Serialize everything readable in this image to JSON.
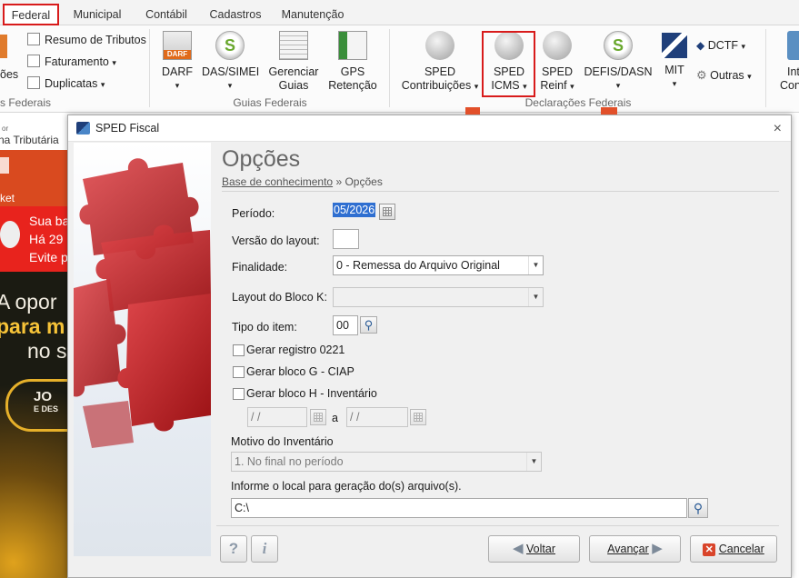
{
  "ribbon_tabs": [
    "Federal",
    "Municipal",
    "Contábil",
    "Cadastros",
    "Manutenção"
  ],
  "ribbon": {
    "left_cut_label": "ões",
    "left_cut_group": "s Federais",
    "small_buttons": [
      "Resumo de Tributos",
      "Faturamento",
      "Duplicatas"
    ],
    "guias": {
      "buttons": [
        {
          "line1": "DARF",
          "line2": "",
          "icon_text": "DARF"
        },
        {
          "line1": "DAS/SIMEI",
          "line2": ""
        },
        {
          "line1": "Gerenciar",
          "line2": "Guias"
        },
        {
          "line1": "GPS",
          "line2": "Retenção"
        }
      ],
      "group_label": "Guias Federais"
    },
    "declaracoes": {
      "buttons": [
        {
          "line1": "SPED",
          "line2": "Contribuições"
        },
        {
          "line1": "SPED",
          "line2": "ICMS"
        },
        {
          "line1": "SPED",
          "line2": "Reinf"
        },
        {
          "line1": "DEFIS/DASN",
          "line2": ""
        },
        {
          "line1": "MIT",
          "line2": ""
        }
      ],
      "dctf_label": "DCTF",
      "outras_label": "Outras",
      "group_label": "Declarações Federais"
    },
    "right_cut": {
      "line1": "Int",
      "line2": "Con"
    }
  },
  "side_panel": {
    "top_small": "or",
    "header": "na Tributária",
    "ket": "ket",
    "banner_lines": [
      "Sua ba",
      "Há 29",
      "Evite p"
    ],
    "promo_lines": [
      "A opor",
      "para m",
      "no s"
    ],
    "button_top": "JO",
    "button_bottom": "E DES"
  },
  "dialog": {
    "window_title": "SPED Fiscal",
    "close_glyph": "×",
    "heading": "Opções",
    "breadcrumb_link": "Base de conhecimento",
    "breadcrumb_sep": "»",
    "breadcrumb_current": "Opções",
    "periodo_label": "Período:",
    "periodo_value": "05/2026",
    "versao_label": "Versão do layout:",
    "versao_value": "",
    "finalidade_label": "Finalidade:",
    "finalidade_value": "0 - Remessa do Arquivo Original",
    "layout_bloco_k_label": "Layout do Bloco K:",
    "layout_bloco_k_value": "",
    "tipo_item_label": "Tipo do item:",
    "tipo_item_value": "00",
    "gerar_0221_label": "Gerar registro 0221",
    "gerar_0221_checked": false,
    "gerar_g_label": "Gerar bloco G - CIAP",
    "gerar_g_checked": false,
    "gerar_h_label": "Gerar bloco H - Inventário",
    "gerar_h_checked": false,
    "date_from_placeholder": "/  /",
    "date_sep_label": "a",
    "date_to_placeholder": "/  /",
    "motivo_label": "Motivo do Inventário",
    "motivo_value": "1. No final no período",
    "local_label": "Informe o local para geração do(s) arquivo(s).",
    "local_value": "C:\\",
    "help_button": "?",
    "info_button": "i",
    "voltar_label": "Voltar",
    "avancar_label": "Avançar",
    "cancelar_label": "Cancelar"
  },
  "colors": {
    "highlight": "#d81b1b",
    "dialog_bg": "#f0f0f0",
    "heading": "#666666"
  }
}
